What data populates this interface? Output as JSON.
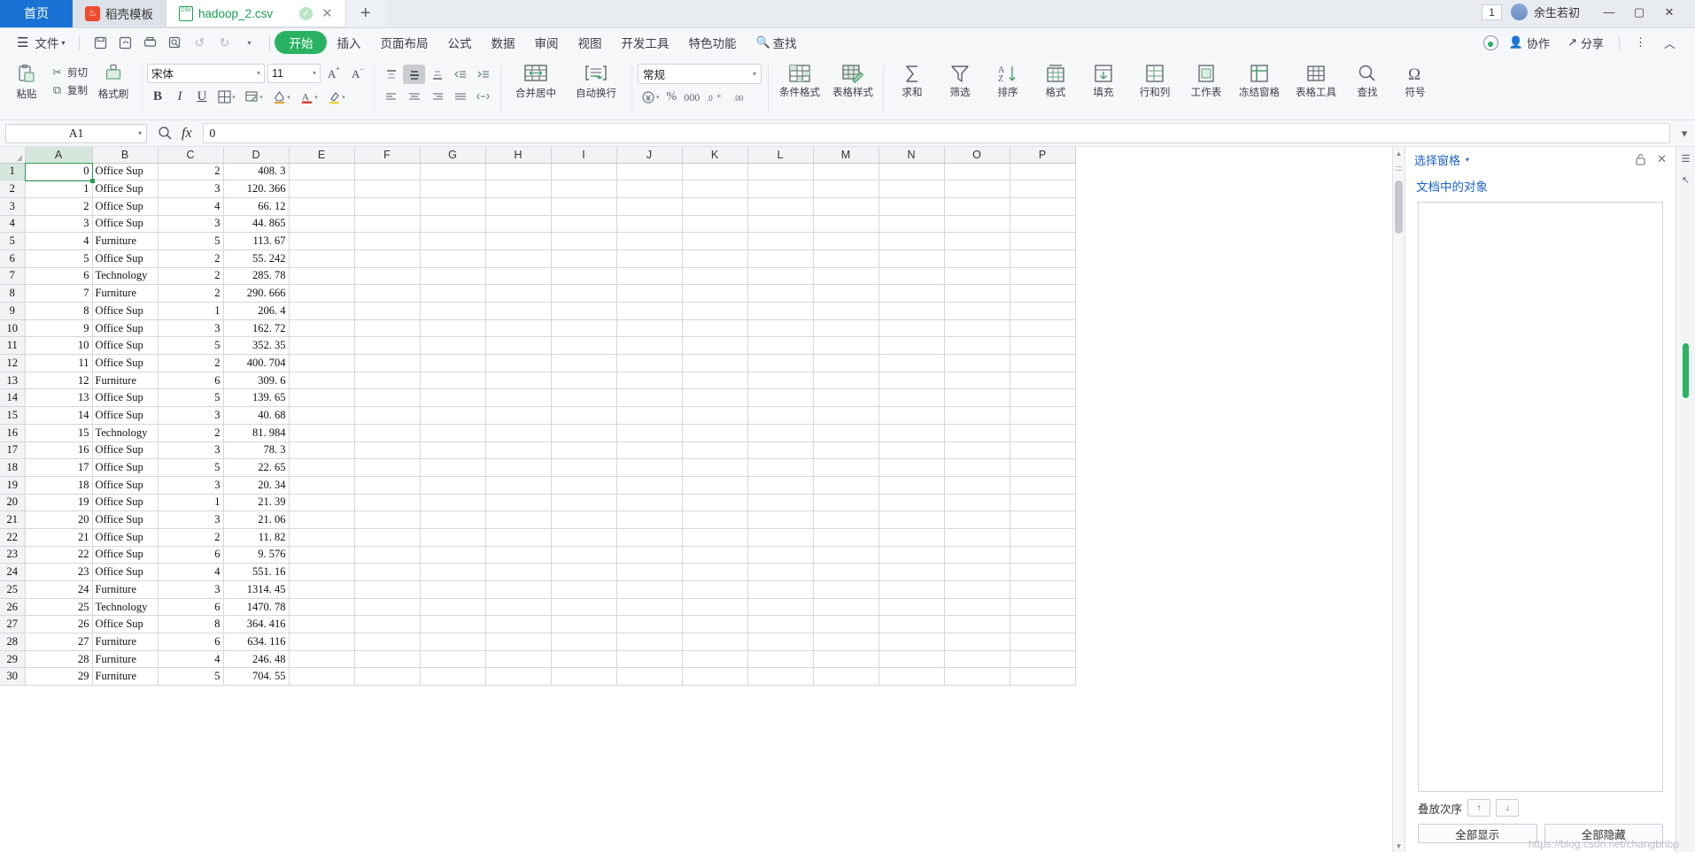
{
  "tabbar": {
    "home_tab": "首页",
    "template_tab": "稻壳模板",
    "active_tab": "hadoop_2.csv",
    "new_tab_label": "+",
    "close_label": "✕",
    "doc_count": "1",
    "user_name": "余生若初",
    "minimize": "—",
    "maximize": "▢",
    "close_window": "✕"
  },
  "menu": {
    "file_label": "文件",
    "items": [
      "开始",
      "插入",
      "页面布局",
      "公式",
      "数据",
      "审阅",
      "视图",
      "开发工具",
      "特色功能"
    ],
    "search_label": "查找",
    "collab_label": "协作",
    "share_label": "分享",
    "quick_icons": [
      "save-icon",
      "save-as-icon",
      "print-icon",
      "print-preview-icon",
      "undo-icon",
      "redo-icon",
      "customize-icon"
    ]
  },
  "ribbon": {
    "paste_label": "粘贴",
    "cut_label": "剪切",
    "copy_label": "复制",
    "format_painter_label": "格式刷",
    "font_name": "宋体",
    "font_size": "11",
    "grow_font": "A⁺",
    "shrink_font": "A⁻",
    "bold": "B",
    "italic": "I",
    "underline": "U",
    "borders": "田",
    "cell_style": "▤",
    "fill_color": "◇",
    "font_color": "A",
    "merge_label": "合并居中",
    "wrap_label": "自动换行",
    "number_format": "常规",
    "num_buttons": [
      "¥",
      "%",
      "000",
      ".0+",
      ".00"
    ],
    "cond_format_label": "条件格式",
    "table_style_label": "表格样式",
    "sum_label": "求和",
    "filter_label": "筛选",
    "sort_label": "排序",
    "format_label": "格式",
    "fill_label": "填充",
    "rowcol_label": "行和列",
    "sheet_label": "工作表",
    "freeze_label": "冻结窗格",
    "table_tools_label": "表格工具",
    "find_label": "查找",
    "symbol_label": "符号"
  },
  "formula_bar": {
    "name_box": "A1",
    "formula_value": "0",
    "fx_label": "fx"
  },
  "pane": {
    "title": "选择窗格",
    "subtitle": "文档中的对象",
    "order_label": "叠放次序",
    "up_label": "↑",
    "down_label": "↓",
    "show_all_label": "全部显示",
    "hide_all_label": "全部隐藏",
    "pin_icon": "unlock-icon",
    "close_icon": "✕"
  },
  "watermark": "https://blog.csdn.net/changbhbp",
  "sheet": {
    "columns": [
      "A",
      "B",
      "C",
      "D",
      "E",
      "F",
      "G",
      "H",
      "I",
      "J",
      "K",
      "L",
      "M",
      "N",
      "O",
      "P"
    ],
    "selected_cell": "A1",
    "rows": [
      {
        "n": "1",
        "a": "0",
        "b": "Office Sup",
        "c": "2",
        "d": "408. 3"
      },
      {
        "n": "2",
        "a": "1",
        "b": "Office Sup",
        "c": "3",
        "d": "120. 366"
      },
      {
        "n": "3",
        "a": "2",
        "b": "Office Sup",
        "c": "4",
        "d": "66. 12"
      },
      {
        "n": "4",
        "a": "3",
        "b": "Office Sup",
        "c": "3",
        "d": "44. 865"
      },
      {
        "n": "5",
        "a": "4",
        "b": "Furniture",
        "c": "5",
        "d": "113. 67"
      },
      {
        "n": "6",
        "a": "5",
        "b": "Office Sup",
        "c": "2",
        "d": "55. 242"
      },
      {
        "n": "7",
        "a": "6",
        "b": "Technology",
        "c": "2",
        "d": "285. 78"
      },
      {
        "n": "8",
        "a": "7",
        "b": "Furniture",
        "c": "2",
        "d": "290. 666"
      },
      {
        "n": "9",
        "a": "8",
        "b": "Office Sup",
        "c": "1",
        "d": "206. 4"
      },
      {
        "n": "10",
        "a": "9",
        "b": "Office Sup",
        "c": "3",
        "d": "162. 72"
      },
      {
        "n": "11",
        "a": "10",
        "b": "Office Sup",
        "c": "5",
        "d": "352. 35"
      },
      {
        "n": "12",
        "a": "11",
        "b": "Office Sup",
        "c": "2",
        "d": "400. 704"
      },
      {
        "n": "13",
        "a": "12",
        "b": "Furniture",
        "c": "6",
        "d": "309. 6"
      },
      {
        "n": "14",
        "a": "13",
        "b": "Office Sup",
        "c": "5",
        "d": "139. 65"
      },
      {
        "n": "15",
        "a": "14",
        "b": "Office Sup",
        "c": "3",
        "d": "40. 68"
      },
      {
        "n": "16",
        "a": "15",
        "b": "Technology",
        "c": "2",
        "d": "81. 984"
      },
      {
        "n": "17",
        "a": "16",
        "b": "Office Sup",
        "c": "3",
        "d": "78. 3"
      },
      {
        "n": "18",
        "a": "17",
        "b": "Office Sup",
        "c": "5",
        "d": "22. 65"
      },
      {
        "n": "19",
        "a": "18",
        "b": "Office Sup",
        "c": "3",
        "d": "20. 34"
      },
      {
        "n": "20",
        "a": "19",
        "b": "Office Sup",
        "c": "1",
        "d": "21. 39"
      },
      {
        "n": "21",
        "a": "20",
        "b": "Office Sup",
        "c": "3",
        "d": "21. 06"
      },
      {
        "n": "22",
        "a": "21",
        "b": "Office Sup",
        "c": "2",
        "d": "11. 82"
      },
      {
        "n": "23",
        "a": "22",
        "b": "Office Sup",
        "c": "6",
        "d": "9. 576"
      },
      {
        "n": "24",
        "a": "23",
        "b": "Office Sup",
        "c": "4",
        "d": "551. 16"
      },
      {
        "n": "25",
        "a": "24",
        "b": "Furniture",
        "c": "3",
        "d": "1314. 45"
      },
      {
        "n": "26",
        "a": "25",
        "b": "Technology",
        "c": "6",
        "d": "1470. 78"
      },
      {
        "n": "27",
        "a": "26",
        "b": "Office Sup",
        "c": "8",
        "d": "364. 416"
      },
      {
        "n": "28",
        "a": "27",
        "b": "Furniture",
        "c": "6",
        "d": "634. 116"
      },
      {
        "n": "29",
        "a": "28",
        "b": "Furniture",
        "c": "4",
        "d": "246. 48"
      },
      {
        "n": "30",
        "a": "29",
        "b": "Furniture",
        "c": "5",
        "d": "704. 55"
      }
    ]
  }
}
